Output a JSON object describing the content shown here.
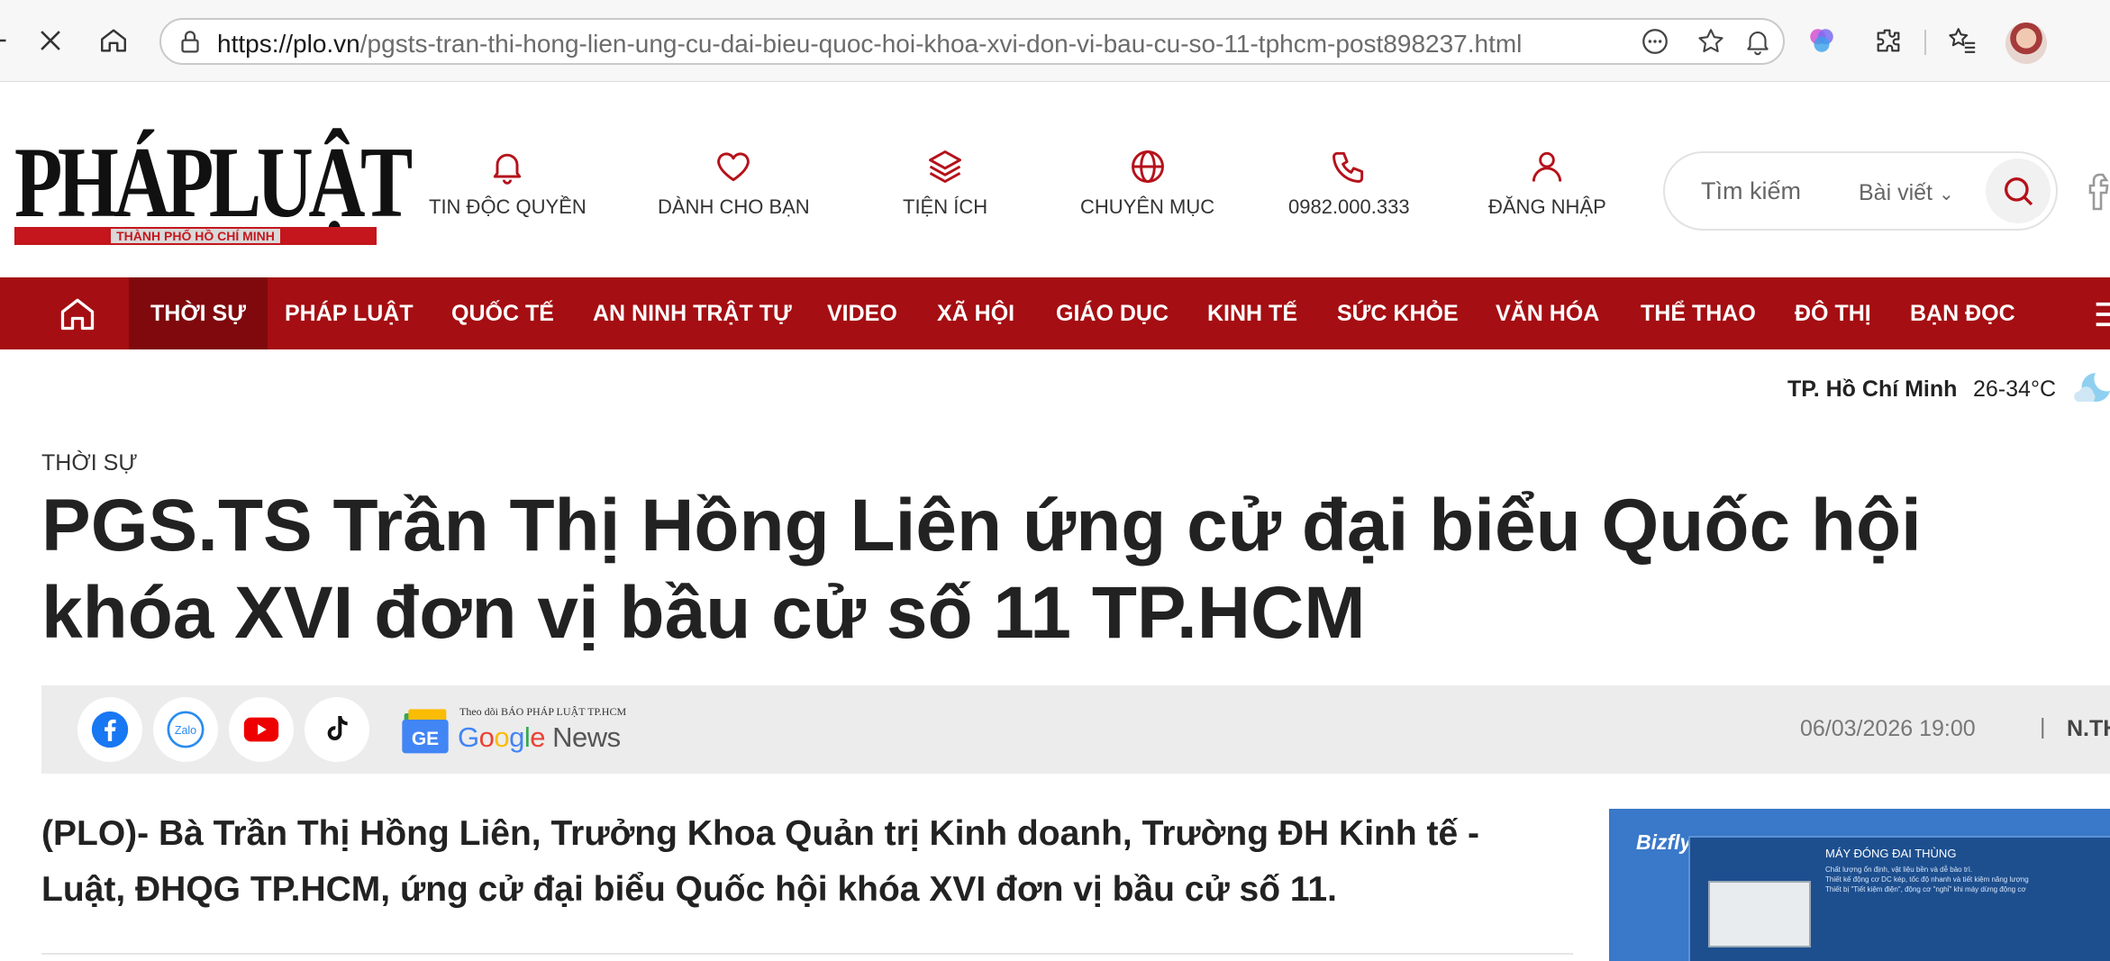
{
  "browser": {
    "url_host": "https://plo.vn",
    "url_path": "/pgsts-tran-thi-hong-lien-ung-cu-dai-bieu-quoc-hoi-khoa-xvi-don-vi-bau-cu-so-11-tphcm-post898237.html",
    "icons": [
      "close-icon",
      "home-icon",
      "lock-icon",
      "more-icon",
      "star-icon",
      "bell-icon",
      "copilot-icon",
      "extensions-icon",
      "favorites-icon",
      "avatar"
    ]
  },
  "site": {
    "logo_text": "PHÁPLUẬT",
    "logo_sub": "THÀNH PHỐ HỒ CHÍ MINH",
    "nav": [
      {
        "label": "TIN ĐỘC QUYỀN",
        "icon": "bell-icon"
      },
      {
        "label": "DÀNH CHO BẠN",
        "icon": "heart-icon"
      },
      {
        "label": "TIỆN ÍCH",
        "icon": "layers-icon"
      },
      {
        "label": "CHUYÊN MỤC",
        "icon": "globe-icon"
      },
      {
        "label": "0982.000.333",
        "icon": "phone-icon"
      },
      {
        "label": "ĐĂNG NHẬP",
        "icon": "user-icon"
      }
    ],
    "search": {
      "placeholder": "Tìm kiếm",
      "type": "Bài viết"
    }
  },
  "categories": [
    "THỜI SỰ",
    "PHÁP LUẬT",
    "QUỐC TẾ",
    "AN NINH TRẬT TỰ",
    "VIDEO",
    "XÃ HỘI",
    "GIÁO DỤC",
    "KINH TẾ",
    "SỨC KHỎE",
    "VĂN HÓA",
    "THỂ THAO",
    "ĐÔ THỊ",
    "BẠN ĐỌC"
  ],
  "weather": {
    "city": "TP. Hồ Chí Minh",
    "temp": "26-34°C"
  },
  "article": {
    "section": "THỜI SỰ",
    "headline": "PGS.TS Trần Thị Hồng Liên ứng cử đại biểu Quốc hội khóa XVI đơn vị bầu cử số 11 TP.HCM",
    "share": {
      "follow_text": "Theo dõi BÁO PHÁP LUẬT TP.HCM",
      "brand_parts": [
        "G",
        "o",
        "o",
        "g",
        "l",
        "e"
      ],
      "brand_news": "News",
      "gnews_badge": "GE"
    },
    "datetime": "06/03/2026 19:00",
    "separator": "|",
    "author": "N.THẢO",
    "lead": "(PLO)- Bà Trần Thị Hồng Liên, Trưởng Khoa Quản trị Kinh doanh, Trường ĐH Kinh tế - Luật, ĐHQG TP.HCM, ứng cử đại biểu Quốc hội khóa XVI đơn vị bầu cử số 11."
  },
  "ad": {
    "brand": "Bizfly",
    "title": "MÁY ĐÓNG ĐAI THÙNG",
    "lines": [
      "Chất lượng ổn định, vật liệu bền và dễ bảo trì.",
      "Thiết kế động cơ DC kép, tốc độ nhanh và tiết kiệm năng lượng",
      "Thiết bị \"Tiết kiệm điện\", động cơ \"nghỉ\" khi máy dừng động cơ"
    ]
  },
  "colors": {
    "brand_red": "#a50e12",
    "active_red": "#7f090c",
    "icon_red": "#b5121b"
  }
}
